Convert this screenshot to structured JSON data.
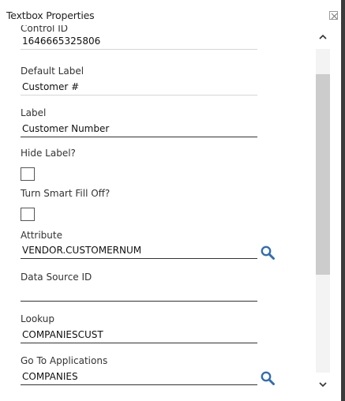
{
  "dialog": {
    "title": "Textbox Properties",
    "close_icon": "close-icon"
  },
  "fields": {
    "control_id": {
      "label": "Control ID",
      "value": "1646665325806"
    },
    "default_label": {
      "label": "Default Label",
      "value": "Customer #"
    },
    "label": {
      "label": "Label",
      "value": "Customer Number"
    },
    "hide_label": {
      "label": "Hide Label?",
      "checked": false
    },
    "smart_fill": {
      "label": "Turn Smart Fill Off?",
      "checked": false
    },
    "attribute": {
      "label": "Attribute",
      "value": "VENDOR.CUSTOMERNUM",
      "icon": "search-icon"
    },
    "data_source_id": {
      "label": "Data Source ID",
      "value": ""
    },
    "lookup": {
      "label": "Lookup",
      "value": "COMPANIESCUST"
    },
    "go_to_applications": {
      "label": "Go To Applications",
      "value": "COMPANIES",
      "icon": "search-icon"
    }
  },
  "colors": {
    "accent_icon": "#2f6db5",
    "scroll_thumb": "#cccccc"
  }
}
